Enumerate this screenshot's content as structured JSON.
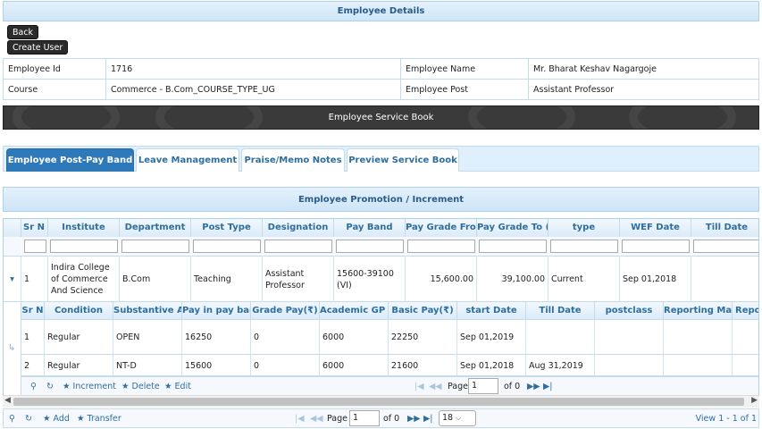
{
  "employee_details_title": "Employee Details",
  "back_label": "Back",
  "create_user_label": "Create User",
  "info": {
    "employee_id_label": "Employee Id",
    "employee_id_value": "1716",
    "employee_name_label": "Employee Name",
    "employee_name_value": "Mr. Bharat Keshav Nagargoje",
    "course_label": "Course",
    "course_value": "Commerce - B.Com_COURSE_TYPE_UG",
    "employee_post_label": "Employee Post",
    "employee_post_value": "Assistant Professor"
  },
  "service_book_title": "Employee Service Book",
  "tabs": [
    {
      "label": "Employee Post-Pay Band"
    },
    {
      "label": "Leave Management"
    },
    {
      "label": "Praise/Memo Notes"
    },
    {
      "label": "Preview Service Book"
    }
  ],
  "grid_title": "Employee Promotion / Increment",
  "columns": [
    "Sr N",
    "Institute",
    "Department",
    "Post Type",
    "Designation",
    "Pay Band",
    "Pay Grade Fror",
    "Pay Grade To (",
    "type",
    "WEF Date",
    "Till Date"
  ],
  "row": {
    "expand_icon": "triangle-down",
    "sr": "1",
    "institute": "Indira College of Commerce And Science",
    "department": "B.Com",
    "post_type": "Teaching",
    "designation": "Assistant Professor",
    "pay_band": "15600-39100 (VI)",
    "pay_grade_from": "15,600.00",
    "pay_grade_to": "39,100.00",
    "type": "Current",
    "wef_date": "Sep 01,2018",
    "till_date": ""
  },
  "sub_columns": [
    "Sr N",
    "Condition",
    "Substantive A",
    "Pay in pay bar",
    "Grade Pay(₹)",
    "Academic GP (",
    "Basic Pay(₹)",
    "start Date",
    "Till Date",
    "postclass",
    "Reporting Mar",
    "Repor"
  ],
  "sub_rows": [
    {
      "sr": "1",
      "condition": "Regular",
      "substantive": "OPEN",
      "pay_in_band": "16250",
      "grade_pay": "0",
      "academic_gp": "6000",
      "basic_pay": "22250",
      "start_date": "Sep 01,2019",
      "till_date": ""
    },
    {
      "sr": "2",
      "condition": "Regular",
      "substantive": "NT-D",
      "pay_in_band": "15600",
      "grade_pay": "0",
      "academic_gp": "6000",
      "basic_pay": "21600",
      "start_date": "Sep 01,2018",
      "till_date": "Aug 31,2019"
    }
  ],
  "sub_pager": {
    "increment_label": "Increment",
    "delete_label": "Delete",
    "edit_label": "Edit",
    "page_label": "Page",
    "page_value": "1",
    "of_label": "of 0"
  },
  "pager": {
    "add_label": "Add",
    "transfer_label": "Transfer",
    "page_label": "Page",
    "page_value": "1",
    "of_label": "of 0",
    "rows_value": "18",
    "view_label": "View 1 - 1 of 1"
  },
  "colors": {
    "header_bg": "#cde5f7",
    "header_text": "#2a5b8a",
    "active_tab": "#2e79b9",
    "dark_button": "#2b2b2b"
  }
}
